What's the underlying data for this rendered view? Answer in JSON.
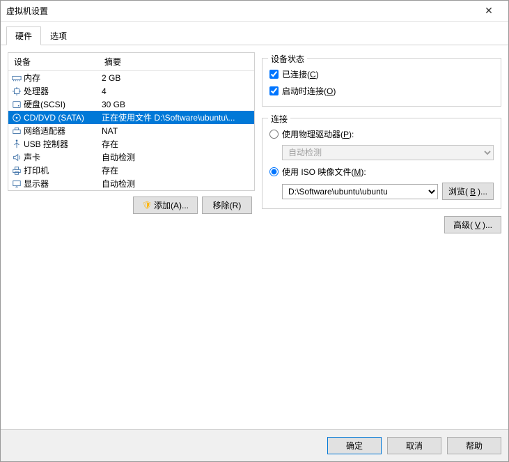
{
  "window": {
    "title": "虚拟机设置"
  },
  "tabs": {
    "hardware": "硬件",
    "options": "选项"
  },
  "list": {
    "header_device": "设备",
    "header_summary": "摘要",
    "items": [
      {
        "name": "内存",
        "summary": "2 GB",
        "icon": "memory"
      },
      {
        "name": "处理器",
        "summary": "4",
        "icon": "cpu"
      },
      {
        "name": "硬盘(SCSI)",
        "summary": "30 GB",
        "icon": "disk"
      },
      {
        "name": "CD/DVD (SATA)",
        "summary": "正在使用文件 D:\\Software\\ubuntu\\...",
        "icon": "cd",
        "selected": true
      },
      {
        "name": "网络适配器",
        "summary": "NAT",
        "icon": "net"
      },
      {
        "name": "USB 控制器",
        "summary": "存在",
        "icon": "usb"
      },
      {
        "name": "声卡",
        "summary": "自动检测",
        "icon": "sound"
      },
      {
        "name": "打印机",
        "summary": "存在",
        "icon": "printer"
      },
      {
        "name": "显示器",
        "summary": "自动检测",
        "icon": "display"
      }
    ]
  },
  "left_buttons": {
    "add": "添加(A)...",
    "remove": "移除(R)"
  },
  "device_status": {
    "title": "设备状态",
    "connected": "已连接(C)",
    "connect_at_power_on": "启动时连接(O)"
  },
  "connection": {
    "title": "连接",
    "use_physical": "使用物理驱动器(P):",
    "physical_auto": "自动检测",
    "use_iso": "使用 ISO 映像文件(M):",
    "iso_path": "D:\\Software\\ubuntu\\ubuntu",
    "browse": "浏览(B)..."
  },
  "advanced": "高级(V)...",
  "footer": {
    "ok": "确定",
    "cancel": "取消",
    "help": "帮助"
  }
}
